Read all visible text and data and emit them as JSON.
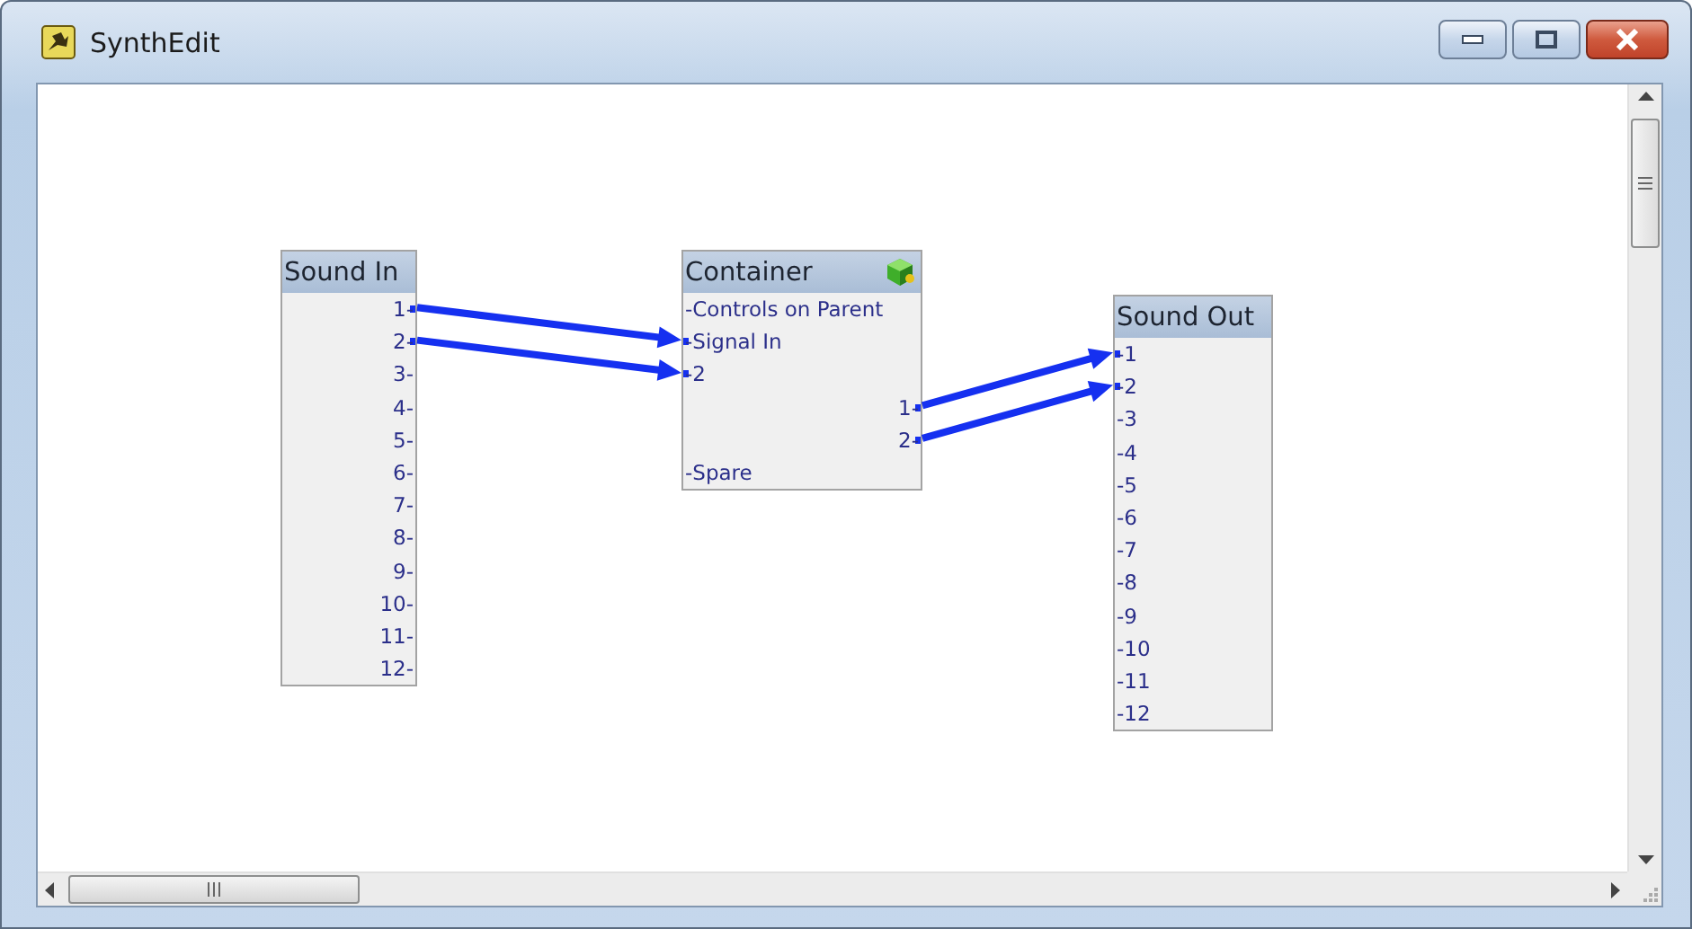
{
  "window": {
    "title": "SynthEdit"
  },
  "nodes": [
    {
      "title": "Sound In",
      "has_icon": false,
      "ports": [
        {
          "label": "1-",
          "kind": "out",
          "connected": true
        },
        {
          "label": "2-",
          "kind": "out",
          "connected": true
        },
        {
          "label": "3-",
          "kind": "out",
          "connected": false
        },
        {
          "label": "4-",
          "kind": "out",
          "connected": false
        },
        {
          "label": "5-",
          "kind": "out",
          "connected": false
        },
        {
          "label": "6-",
          "kind": "out",
          "connected": false
        },
        {
          "label": "7-",
          "kind": "out",
          "connected": false
        },
        {
          "label": "8-",
          "kind": "out",
          "connected": false
        },
        {
          "label": "9-",
          "kind": "out",
          "connected": false
        },
        {
          "label": "10-",
          "kind": "out",
          "connected": false
        },
        {
          "label": "11-",
          "kind": "out",
          "connected": false
        },
        {
          "label": "12-",
          "kind": "out",
          "connected": false
        }
      ]
    },
    {
      "title": "Container",
      "has_icon": true,
      "ports": [
        {
          "label": "-Controls on Parent",
          "kind": "in",
          "connected": false
        },
        {
          "label": "-Signal In",
          "kind": "in",
          "connected": true
        },
        {
          "label": "-2",
          "kind": "in",
          "connected": true
        },
        {
          "label": "1-",
          "kind": "out",
          "connected": true
        },
        {
          "label": "2-",
          "kind": "out",
          "connected": true
        },
        {
          "label": "-Spare",
          "kind": "in",
          "connected": false
        }
      ]
    },
    {
      "title": "Sound Out",
      "has_icon": false,
      "ports": [
        {
          "label": "-1",
          "kind": "in",
          "connected": true
        },
        {
          "label": "-2",
          "kind": "in",
          "connected": true
        },
        {
          "label": "-3",
          "kind": "in",
          "connected": false
        },
        {
          "label": "-4",
          "kind": "in",
          "connected": false
        },
        {
          "label": "-5",
          "kind": "in",
          "connected": false
        },
        {
          "label": "-6",
          "kind": "in",
          "connected": false
        },
        {
          "label": "-7",
          "kind": "in",
          "connected": false
        },
        {
          "label": "-8",
          "kind": "in",
          "connected": false
        },
        {
          "label": "-9",
          "kind": "in",
          "connected": false
        },
        {
          "label": "-10",
          "kind": "in",
          "connected": false
        },
        {
          "label": "-11",
          "kind": "in",
          "connected": false
        },
        {
          "label": "-12",
          "kind": "in",
          "connected": false
        }
      ]
    }
  ]
}
